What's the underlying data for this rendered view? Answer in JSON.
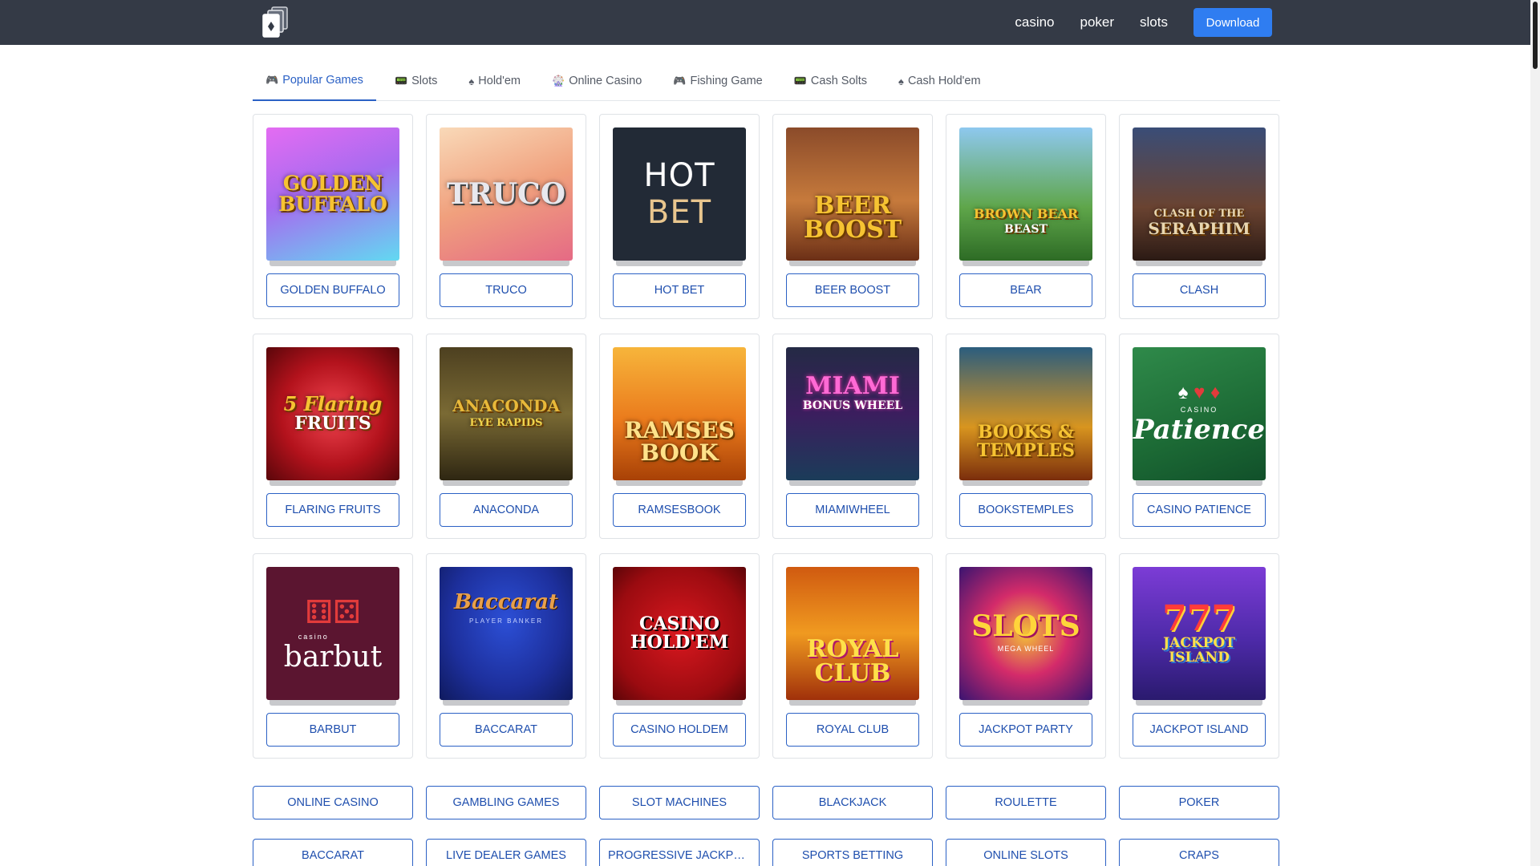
{
  "header": {
    "nav": [
      {
        "label": "casino"
      },
      {
        "label": "poker"
      },
      {
        "label": "slots"
      }
    ],
    "download_label": "Download",
    "colors": {
      "bar": "#343a46",
      "download": "#2f7df1",
      "accent": "#2b61c5"
    }
  },
  "tabs": [
    {
      "icon": "🎮",
      "label": "Popular Games",
      "active": true
    },
    {
      "icon": "📟",
      "label": "Slots"
    },
    {
      "icon": "♠",
      "label": "Hold'em"
    },
    {
      "icon": "🎡",
      "label": "Online Casino"
    },
    {
      "icon": "🎮",
      "label": "Fishing Game"
    },
    {
      "icon": "📟",
      "label": "Cash Solts"
    },
    {
      "icon": "♠",
      "label": "Cash Hold'em"
    }
  ],
  "games": [
    {
      "label": "GOLDEN BUFFALO",
      "art": [
        "GOLDEN",
        "BUFFALO"
      ]
    },
    {
      "label": "TRUCO",
      "art": [
        "TRUCO"
      ]
    },
    {
      "label": "HOT BET",
      "art": [
        "HOT",
        "BET"
      ]
    },
    {
      "label": "BEER BOOST",
      "art": [
        "BEER",
        "BOOST"
      ]
    },
    {
      "label": "BEAR",
      "art": [
        "BROWN BEAR",
        "BEAST"
      ]
    },
    {
      "label": "CLASH",
      "art": [
        "CLASH OF THE",
        "SERAPHIM"
      ]
    },
    {
      "label": "FLARING FRUITS",
      "art": [
        "5 Flaring",
        "FRUITS"
      ]
    },
    {
      "label": "ANACONDA",
      "art": [
        "ANACONDA",
        "EYE RAPIDS"
      ]
    },
    {
      "label": "RAMSESBOOK",
      "art": [
        "RAMSES",
        "BOOK"
      ]
    },
    {
      "label": "MIAMIWHEEL",
      "art": [
        "MIAMI",
        "BONUS WHEEL"
      ]
    },
    {
      "label": "BOOKSTEMPLES",
      "art": [
        "BOOKS &",
        "TEMPLES"
      ]
    },
    {
      "label": "CASINO PATIENCE",
      "art": [
        "CASINO",
        "Patience"
      ]
    },
    {
      "label": "BARBUT",
      "art": [
        "casino",
        "barbut"
      ]
    },
    {
      "label": "BACCARAT",
      "art": [
        "Baccarat",
        "PLAYER BANKER"
      ]
    },
    {
      "label": "CASINO HOLDEM",
      "art": [
        "CASINO",
        "HOLD'EM"
      ]
    },
    {
      "label": "ROYAL CLUB",
      "art": [
        "ROYAL",
        "CLUB"
      ]
    },
    {
      "label": "JACKPOT PARTY",
      "art": [
        "SLOTS",
        "MEGA WHEEL"
      ]
    },
    {
      "label": "JACKPOT ISLAND",
      "art": [
        "777",
        "JACKPOT ISLAND"
      ]
    }
  ],
  "categories": [
    {
      "label": "ONLINE CASINO"
    },
    {
      "label": "GAMBLING GAMES"
    },
    {
      "label": "SLOT MACHINES"
    },
    {
      "label": "BLACKJACK"
    },
    {
      "label": "ROULETTE"
    },
    {
      "label": "POKER"
    },
    {
      "label": "BACCARAT"
    },
    {
      "label": "LIVE DEALER GAMES"
    },
    {
      "label": "PROGRESSIVE JACKPOTS"
    },
    {
      "label": "SPORTS BETTING"
    },
    {
      "label": "ONLINE SLOTS"
    },
    {
      "label": "CRAPS"
    }
  ]
}
